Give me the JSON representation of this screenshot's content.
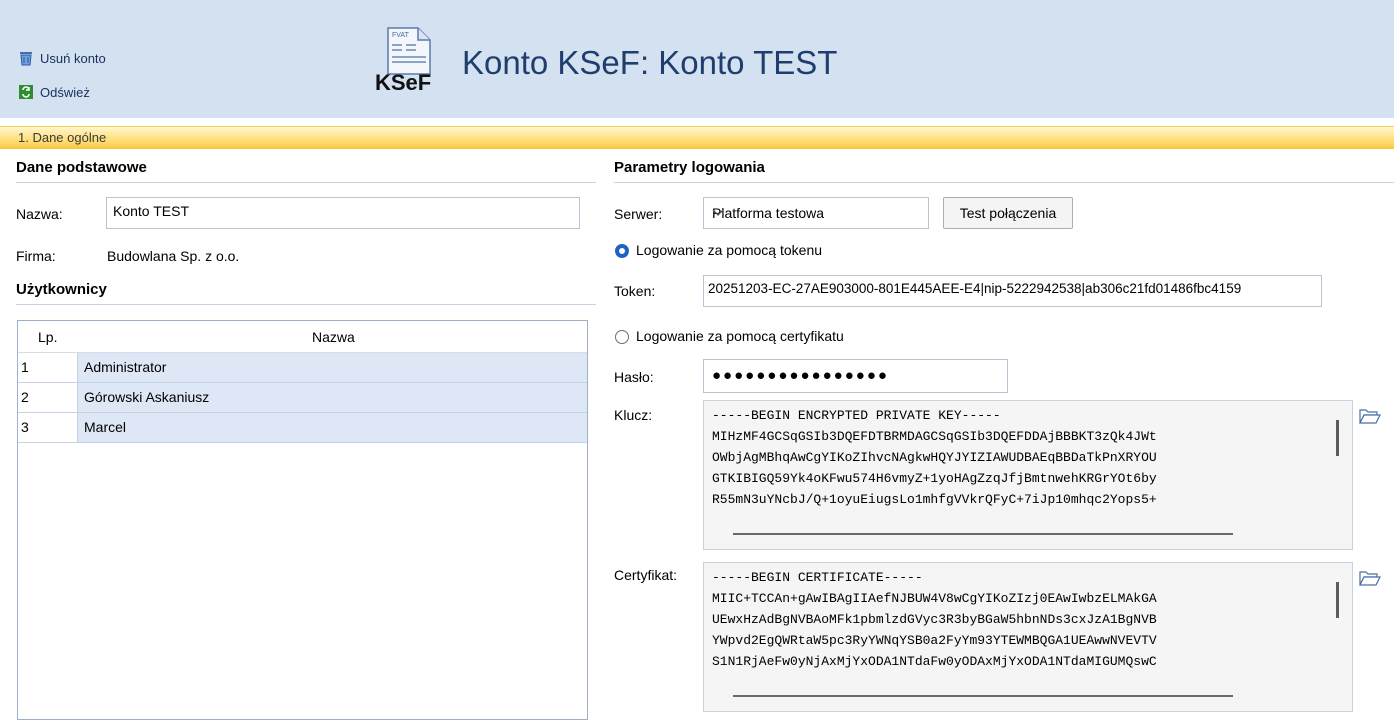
{
  "toolbar": {
    "delete_label": "Usuń konto",
    "refresh_label": "Odśwież"
  },
  "header": {
    "title": "Konto KSeF: Konto TEST",
    "logo_small": "FVAT",
    "logo_text": "KSeF"
  },
  "tab": {
    "label": "1. Dane ogólne"
  },
  "basic": {
    "title": "Dane podstawowe",
    "name_label": "Nazwa:",
    "name_value": "Konto TEST",
    "company_label": "Firma:",
    "company_value": "Budowlana Sp. z o.o."
  },
  "users": {
    "title": "Użytkownicy",
    "columns": [
      "Lp.",
      "Nazwa"
    ],
    "rows": [
      {
        "lp": "1",
        "name": "Administrator"
      },
      {
        "lp": "2",
        "name": "Górowski Askaniusz"
      },
      {
        "lp": "3",
        "name": "Marcel"
      }
    ]
  },
  "login": {
    "title": "Parametry logowania",
    "server_label": "Serwer:",
    "server_value": "Platforma testowa",
    "test_button": "Test połączenia",
    "token_radio": "Logowanie za pomocą tokenu",
    "token_label": "Token:",
    "token_value": "20251203-EC-27AE903000-801E445AEE-E4|nip-5222942538|ab306c21fd01486fbc4159",
    "cert_radio": "Logowanie za pomocą certyfikatu",
    "password_label": "Hasło:",
    "password_value": "●●●●●●●●●●●●●●●●",
    "key_label": "Klucz:",
    "key_value": "-----BEGIN ENCRYPTED PRIVATE KEY-----\nMIHzMF4GCSqGSIb3DQEFDTBRMDAGCSqGSIb3DQEFDDAjBBBKT3zQk4JWt\nOWbjAgMBhqAwCgYIKoZIhvcNAgkwHQYJYIZIAWUDBAEqBBDaTkPnXRYOU\nGTKIBIGQ59Yk4oKFwu574H6vmyZ+1yoHAgZzqJfjBmtnwehKRGrYOt6by\nR55mN3uYNcbJ/Q+1oyuEiugsLo1mhfgVVkrQFyC+7iJp10mhqc2Yops5+",
    "cert_label": "Certyfikat:",
    "cert_value": "-----BEGIN CERTIFICATE-----\nMIIC+TCCAn+gAwIBAgIIAefNJBUW4V8wCgYIKoZIzj0EAwIwbzELMAkGA\nUEwxHzAdBgNVBAoMFk1pbmlzdGVyc3R3byBGaW5hbnNDs3cxJzA1BgNVB\nYWpvd2EgQWRtaW5pc3RyYWNqYSB0a2FyYm93YTEWMBQGA1UEAwwNVEVTV\nS1N1RjAeFw0yNjAxMjYxODA1NTdaFw0yODAxMjYxODA1NTdaMIGUMQswC"
  },
  "colors": {
    "header_bg": "#d3e1f1",
    "title": "#1f3e6e",
    "tab_bar": "#ffd96a",
    "row_selected": "#dde7f5",
    "radio_on": "#1e63c2"
  },
  "icons": [
    "trash-icon",
    "refresh-icon",
    "ksef-document-icon",
    "chevron-down-icon",
    "open-folder-icon"
  ]
}
